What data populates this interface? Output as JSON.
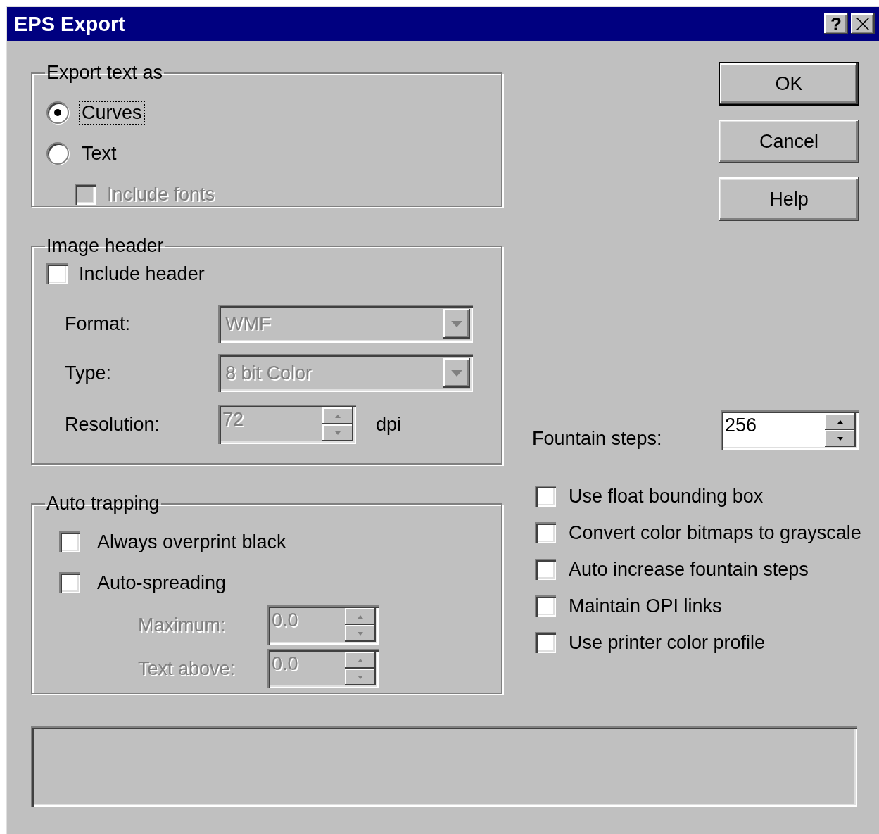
{
  "window": {
    "title": "EPS Export",
    "help_button": "?"
  },
  "export_text_as": {
    "label": "Export text as",
    "options": [
      {
        "label": "Curves",
        "selected": true,
        "focused": true
      },
      {
        "label": "Text",
        "selected": false,
        "focused": false
      }
    ],
    "include_fonts": {
      "label": "Include fonts",
      "checked": false,
      "disabled": true
    }
  },
  "image_header": {
    "label": "Image header",
    "include_header": {
      "label": "Include header",
      "checked": false
    },
    "format": {
      "label": "Format:",
      "value": "WMF",
      "disabled": true
    },
    "type": {
      "label": "Type:",
      "value": "8 bit Color",
      "disabled": true
    },
    "resolution": {
      "label": "Resolution:",
      "value": "72",
      "unit": "dpi",
      "disabled": true
    }
  },
  "auto_trapping": {
    "label": "Auto trapping",
    "options": [
      {
        "label": "Always overprint black",
        "checked": false
      },
      {
        "label": "Auto-spreading",
        "checked": false
      }
    ],
    "maximum": {
      "label": "Maximum:",
      "value": "0.0",
      "disabled": true
    },
    "text_above": {
      "label": "Text above:",
      "value": "0.0",
      "disabled": true
    }
  },
  "buttons": [
    {
      "label": "OK",
      "default": true
    },
    {
      "label": "Cancel",
      "default": false
    },
    {
      "label": "Help",
      "default": false
    }
  ],
  "fountain_steps": {
    "label": "Fountain steps:",
    "value": "256"
  },
  "options": [
    {
      "label": "Use float bounding box",
      "checked": false
    },
    {
      "label": "Convert color bitmaps to grayscale",
      "checked": false
    },
    {
      "label": "Auto increase fountain steps",
      "checked": false
    },
    {
      "label": "Maintain OPI links",
      "checked": false
    },
    {
      "label": "Use printer color profile",
      "checked": false
    }
  ]
}
